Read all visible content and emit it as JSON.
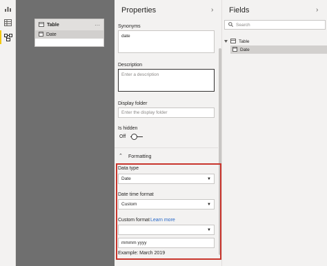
{
  "colors": {
    "canvas": "#6f6f6f",
    "pane_bg": "#f3f2f1",
    "highlight_border": "#c8342b",
    "link": "#2566c7",
    "active_rail": "#f2c811"
  },
  "rail": {
    "items": [
      "report-view-icon",
      "data-view-icon",
      "model-view-icon"
    ],
    "active": "model-view-icon"
  },
  "canvas": {
    "table_card": {
      "title": "Table",
      "menu": "···",
      "fields": [
        "Date"
      ]
    }
  },
  "properties": {
    "title": "Properties",
    "synonyms": {
      "label": "Synonyms",
      "value": "date"
    },
    "description": {
      "label": "Description",
      "placeholder": "Enter a description"
    },
    "display_folder": {
      "label": "Display folder",
      "placeholder": "Enter the display folder"
    },
    "is_hidden": {
      "label": "Is hidden",
      "state": "Off"
    },
    "formatting": {
      "label": "Formatting"
    },
    "data_type": {
      "label": "Data type",
      "value": "Date"
    },
    "date_time_format": {
      "label": "Date time format",
      "value": "Custom"
    },
    "custom_format": {
      "label": "Custom format",
      "link": "Learn more",
      "value": "",
      "input": "mmmm yyyy",
      "example": "Example: March 2019"
    }
  },
  "fields": {
    "title": "Fields",
    "search_placeholder": "Search",
    "tree": {
      "table": "Table",
      "children": [
        "Date"
      ]
    }
  }
}
